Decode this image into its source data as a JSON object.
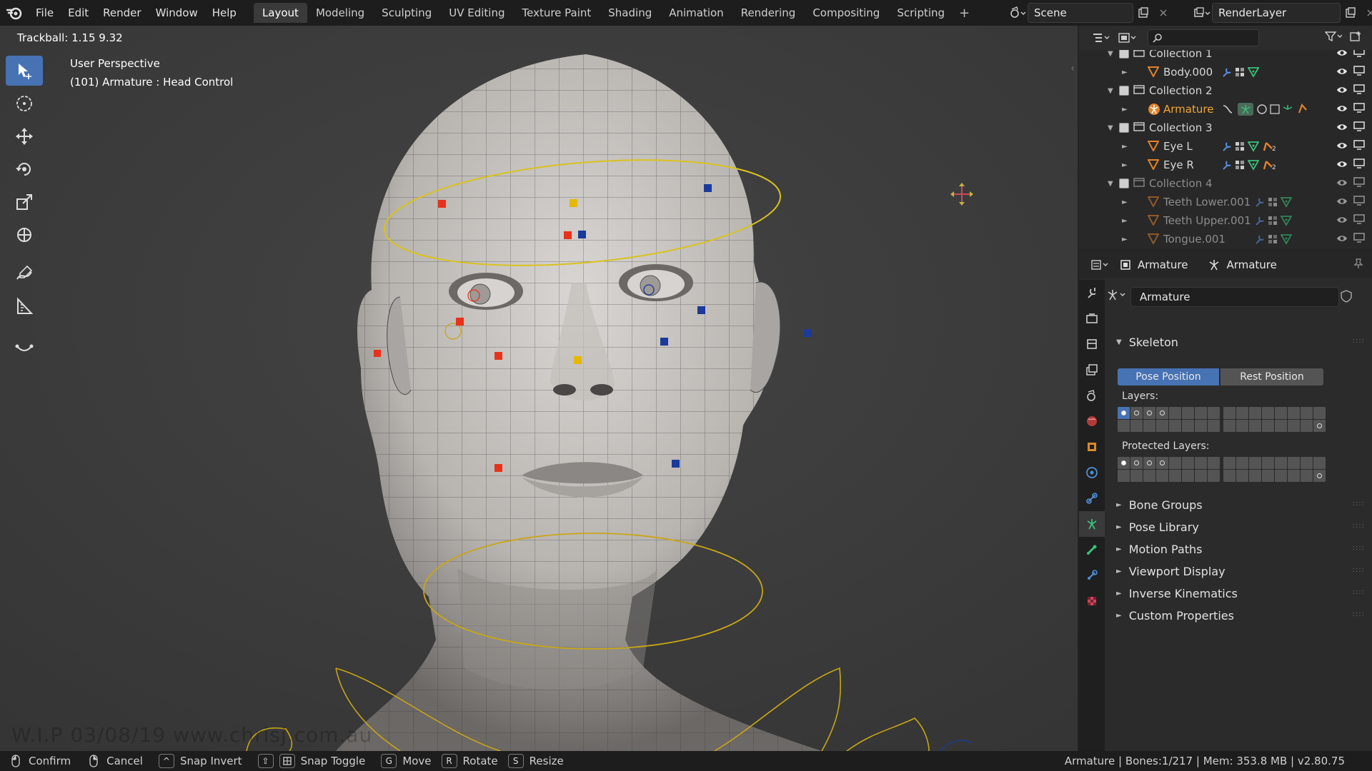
{
  "topbar": {
    "menus": [
      "File",
      "Edit",
      "Render",
      "Window",
      "Help"
    ],
    "tabs": [
      "Layout",
      "Modeling",
      "Sculpting",
      "UV Editing",
      "Texture Paint",
      "Shading",
      "Animation",
      "Rendering",
      "Compositing",
      "Scripting"
    ],
    "active_tab": "Layout",
    "add_tab": "+",
    "scene": "Scene",
    "render_layer": "RenderLayer"
  },
  "viewport": {
    "trackball": "Trackball: 1.15 9.32",
    "perspective": "User Perspective",
    "object_info": "(101) Armature : Head Control",
    "watermark": "W.I.P  03/08/19  www.chrisj.com.au"
  },
  "outliner": {
    "rows": [
      {
        "label": "Collection 1",
        "type": "collection"
      },
      {
        "label": "Body.000",
        "type": "mesh"
      },
      {
        "label": "Collection 2",
        "type": "collection"
      },
      {
        "label": "Armature",
        "type": "armature",
        "selected": true
      },
      {
        "label": "Collection 3",
        "type": "collection"
      },
      {
        "label": "Eye L",
        "type": "mesh",
        "badge": "2"
      },
      {
        "label": "Eye R",
        "type": "mesh",
        "badge": "2"
      },
      {
        "label": "Collection 4",
        "type": "collection",
        "dim": true
      },
      {
        "label": "Teeth Lower.001",
        "type": "mesh",
        "dim": true
      },
      {
        "label": "Teeth Upper.001",
        "type": "mesh",
        "dim": true
      },
      {
        "label": "Tongue.001",
        "type": "mesh",
        "dim": true
      }
    ]
  },
  "properties": {
    "breadcrumb_object": "Armature",
    "breadcrumb_data": "Armature",
    "data_name": "Armature",
    "skeleton": {
      "title": "Skeleton",
      "pose_position": "Pose Position",
      "rest_position": "Rest Position",
      "layers_label": "Layers:",
      "protected_label": "Protected Layers:"
    },
    "collapsed_panels": [
      "Bone Groups",
      "Pose Library",
      "Motion Paths",
      "Viewport Display",
      "Inverse Kinematics",
      "Custom Properties"
    ]
  },
  "statusbar": {
    "hints": [
      {
        "key": "mouse-left",
        "label": "Confirm"
      },
      {
        "key": "mouse-right",
        "label": "Cancel"
      },
      {
        "key": "^",
        "label": "Snap Invert"
      },
      {
        "key": "⇧",
        "label": "Snap Toggle"
      },
      {
        "key": "G",
        "label": "Move"
      },
      {
        "key": "R",
        "label": "Rotate"
      },
      {
        "key": "S",
        "label": "Resize"
      }
    ],
    "info": "Armature | Bones:1/217 | Mem: 353.8 MB | v2.80.75"
  },
  "colors": {
    "accent": "#4772b3",
    "selected_text": "#f3a633",
    "bone_red": "#e8321b",
    "bone_blue": "#1b3a9a",
    "bone_yellow": "#e6b800",
    "control_ring": "#d9c21e"
  }
}
